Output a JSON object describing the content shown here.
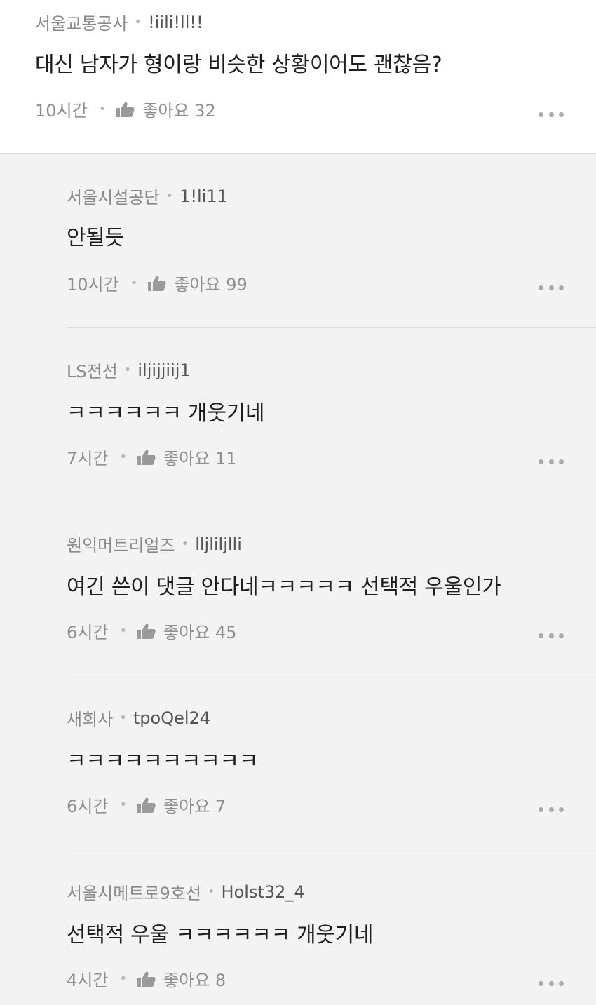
{
  "comments": [
    {
      "company": "서울교통공사",
      "nick": "!iili!ll!!",
      "text": "대신 남자가 형이랑 비슷한 상황이어도 괜찮음?",
      "time": "10시간",
      "likes": "좋아요 32"
    },
    {
      "company": "서울시설공단",
      "nick": "1!li11",
      "text": "안될듯",
      "time": "10시간",
      "likes": "좋아요 99"
    },
    {
      "company": "LS전선",
      "nick": "iljijjiij1",
      "text": "ㅋㅋㅋㅋㅋㅋ 개웃기네",
      "time": "7시간",
      "likes": "좋아요 11"
    },
    {
      "company": "원익머트리얼즈",
      "nick": "lljliljlli",
      "text": "여긴 쓴이 댓글 안다네ㅋㅋㅋㅋㅋ 선택적 우울인가",
      "time": "6시간",
      "likes": "좋아요 45"
    },
    {
      "company": "새회사",
      "nick": "tpoQel24",
      "text": "ㅋㅋㅋㅋㅋㅋㅋㅋㅋㅋ",
      "time": "6시간",
      "likes": "좋아요 7"
    },
    {
      "company": "서울시메트로9호선",
      "nick": "Holst32_4",
      "text": "선택적 우울 ㅋㅋㅋㅋㅋㅋ 개웃기네",
      "time": "4시간",
      "likes": "좋아요 8"
    }
  ],
  "icons": {
    "like": "thumbs-up-icon",
    "more": "more-dots-icon"
  },
  "colors": {
    "top_background": "#ffffff",
    "reply_background": "#f3f3f3",
    "muted_text": "#8a8a8a",
    "body_text": "#1e1e1e"
  }
}
